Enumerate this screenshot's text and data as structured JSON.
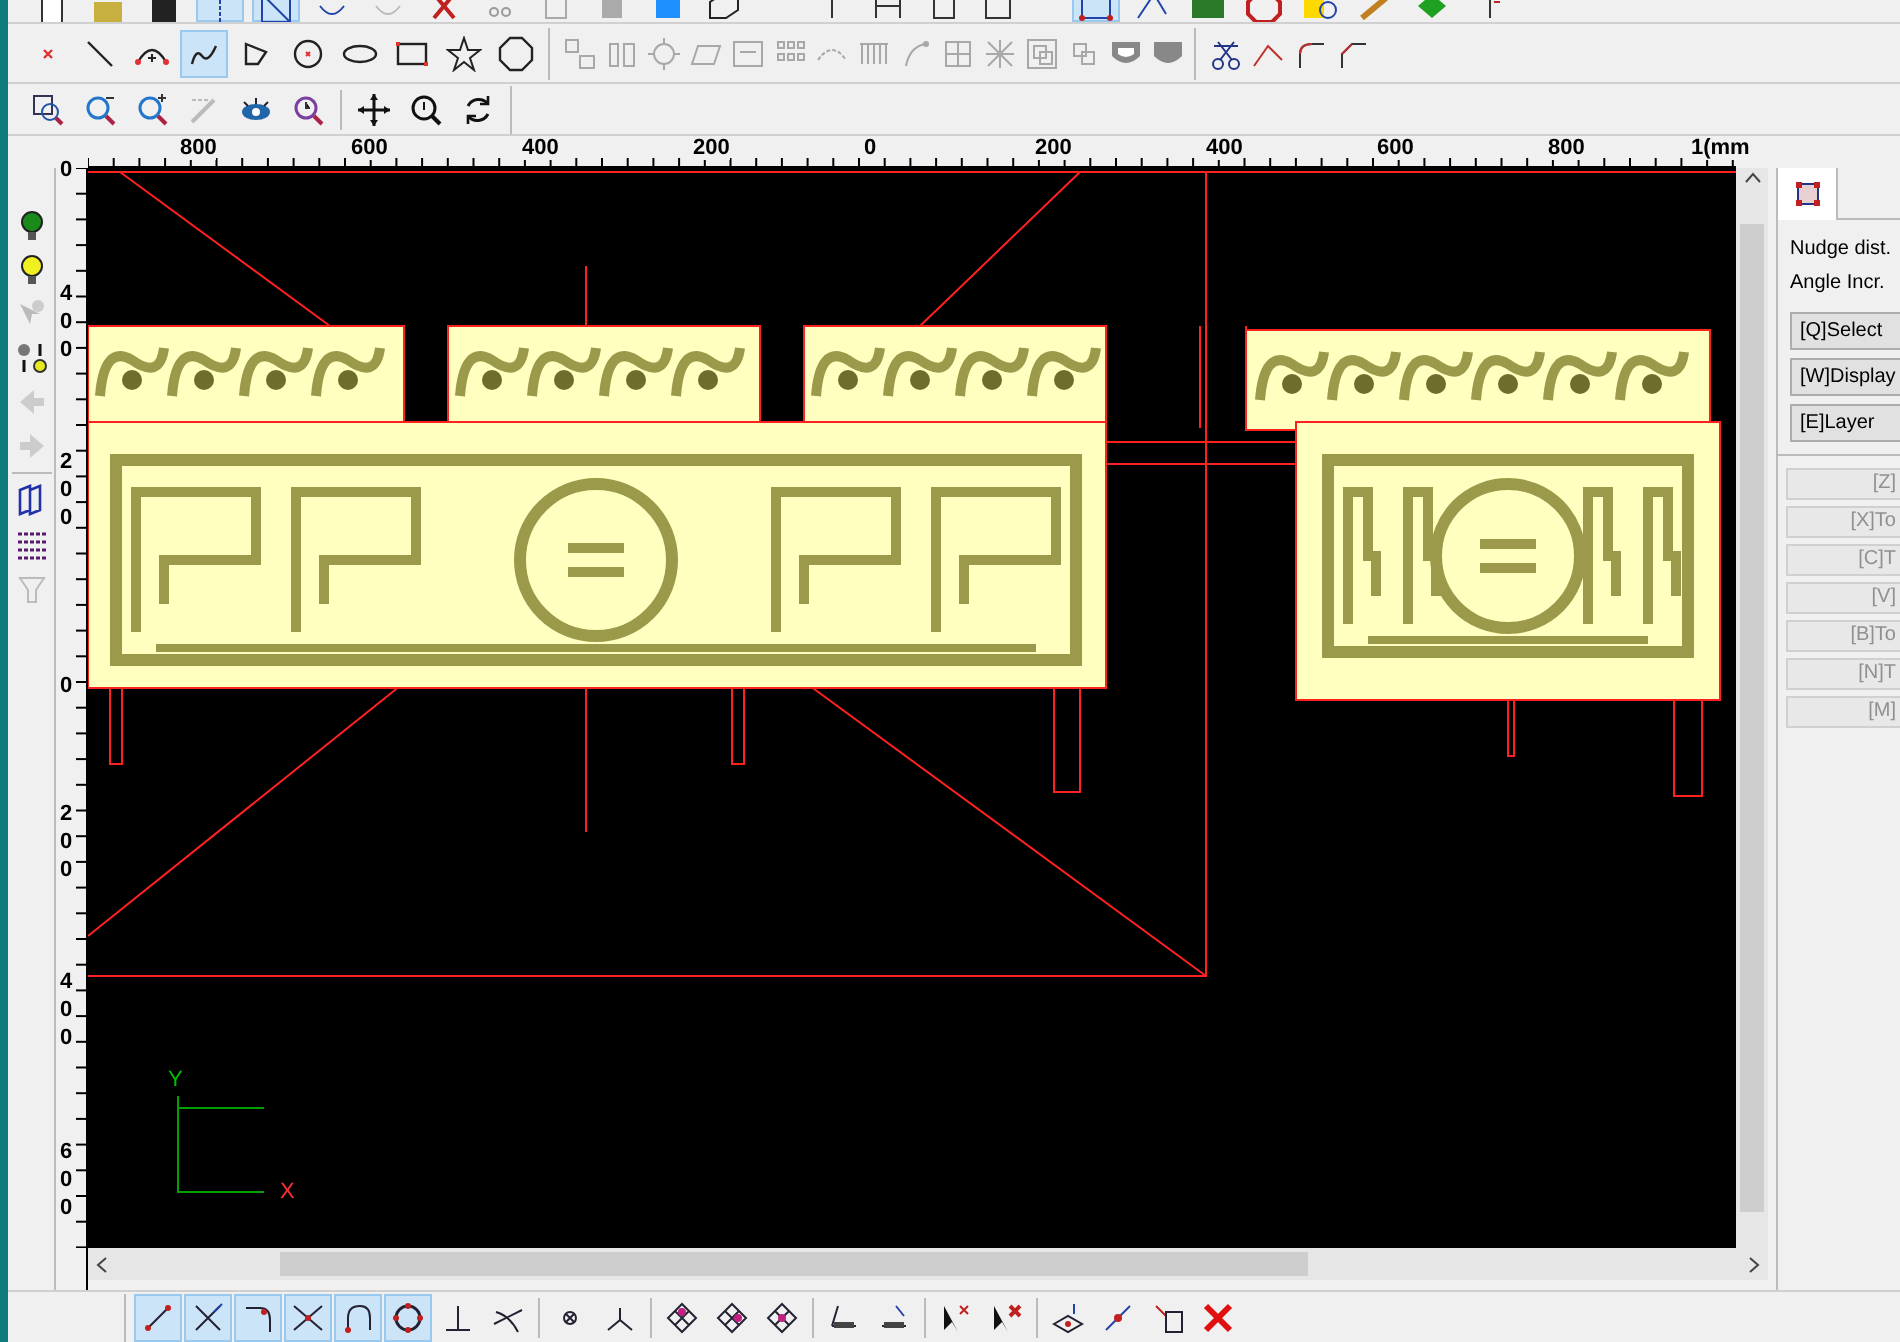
{
  "toolbar_top": [
    {
      "selected": false
    },
    {
      "selected": false
    },
    {
      "selected": false
    },
    {
      "selected": true
    },
    {
      "selected": true
    },
    {
      "selected": false
    },
    {
      "selected": false
    },
    {
      "selected": false
    },
    {
      "selected": false
    },
    {
      "selected": false
    },
    {
      "selected": false
    },
    {
      "selected": false
    },
    {
      "selected": false
    }
  ],
  "toolbar_right_top": [
    {
      "selected": false
    },
    {
      "selected": false
    },
    {
      "selected": false
    },
    {
      "selected": false
    },
    {
      "selected": true
    },
    {
      "selected": false
    },
    {
      "selected": false
    },
    {
      "selected": false
    },
    {
      "selected": false
    },
    {
      "selected": false
    },
    {
      "selected": false
    },
    {
      "selected": false
    }
  ],
  "toolbar_draw": [
    {
      "selected": false
    },
    {
      "selected": false
    },
    {
      "selected": false
    },
    {
      "selected": true
    },
    {
      "selected": false
    },
    {
      "selected": false
    },
    {
      "selected": false
    },
    {
      "selected": false
    },
    {
      "selected": false
    },
    {
      "selected": false
    }
  ],
  "toolbar_view": [
    {
      "selected": false
    },
    {
      "selected": false
    },
    {
      "selected": false
    },
    {
      "selected": false
    },
    {
      "selected": false
    },
    {
      "selected": false
    },
    {
      "selected": false
    },
    {
      "selected": false
    },
    {
      "selected": false
    }
  ],
  "ruler_horizontal": [
    "800",
    "600",
    "400",
    "200",
    "0",
    "200",
    "400",
    "600",
    "800",
    "1(mm"
  ],
  "ruler_vertical": [
    "0",
    "400",
    "200",
    "0",
    "200",
    "400",
    "600"
  ],
  "axis": {
    "y_label": "Y",
    "x_label": "X"
  },
  "panel": {
    "fields": [
      "Nudge dist.",
      "Angle Incr."
    ],
    "buttons": [
      {
        "label": "[Q]Select",
        "disabled": false
      },
      {
        "label": "[W]Display",
        "disabled": false
      },
      {
        "label": "[E]Layer",
        "disabled": false
      }
    ],
    "shortcut_buttons": [
      {
        "label": "[Z]",
        "disabled": true
      },
      {
        "label": "[X]To",
        "disabled": true
      },
      {
        "label": "[C]T",
        "disabled": true
      },
      {
        "label": "[V]",
        "disabled": true
      },
      {
        "label": "[B]To",
        "disabled": true
      },
      {
        "label": "[N]T",
        "disabled": true
      },
      {
        "label": "[M]",
        "disabled": true
      }
    ]
  },
  "toolbar_snap": [
    {
      "selected": true
    },
    {
      "selected": true
    },
    {
      "selected": true
    },
    {
      "selected": true
    },
    {
      "selected": true
    },
    {
      "selected": true
    },
    {
      "selected": false
    },
    {
      "selected": false
    },
    {
      "selected": false
    },
    {
      "selected": false
    },
    {
      "selected": false
    },
    {
      "selected": false
    },
    {
      "selected": false
    },
    {
      "selected": false
    },
    {
      "selected": false
    },
    {
      "selected": false
    },
    {
      "selected": false
    },
    {
      "selected": false
    },
    {
      "selected": false
    },
    {
      "selected": false
    },
    {
      "selected": false
    }
  ]
}
